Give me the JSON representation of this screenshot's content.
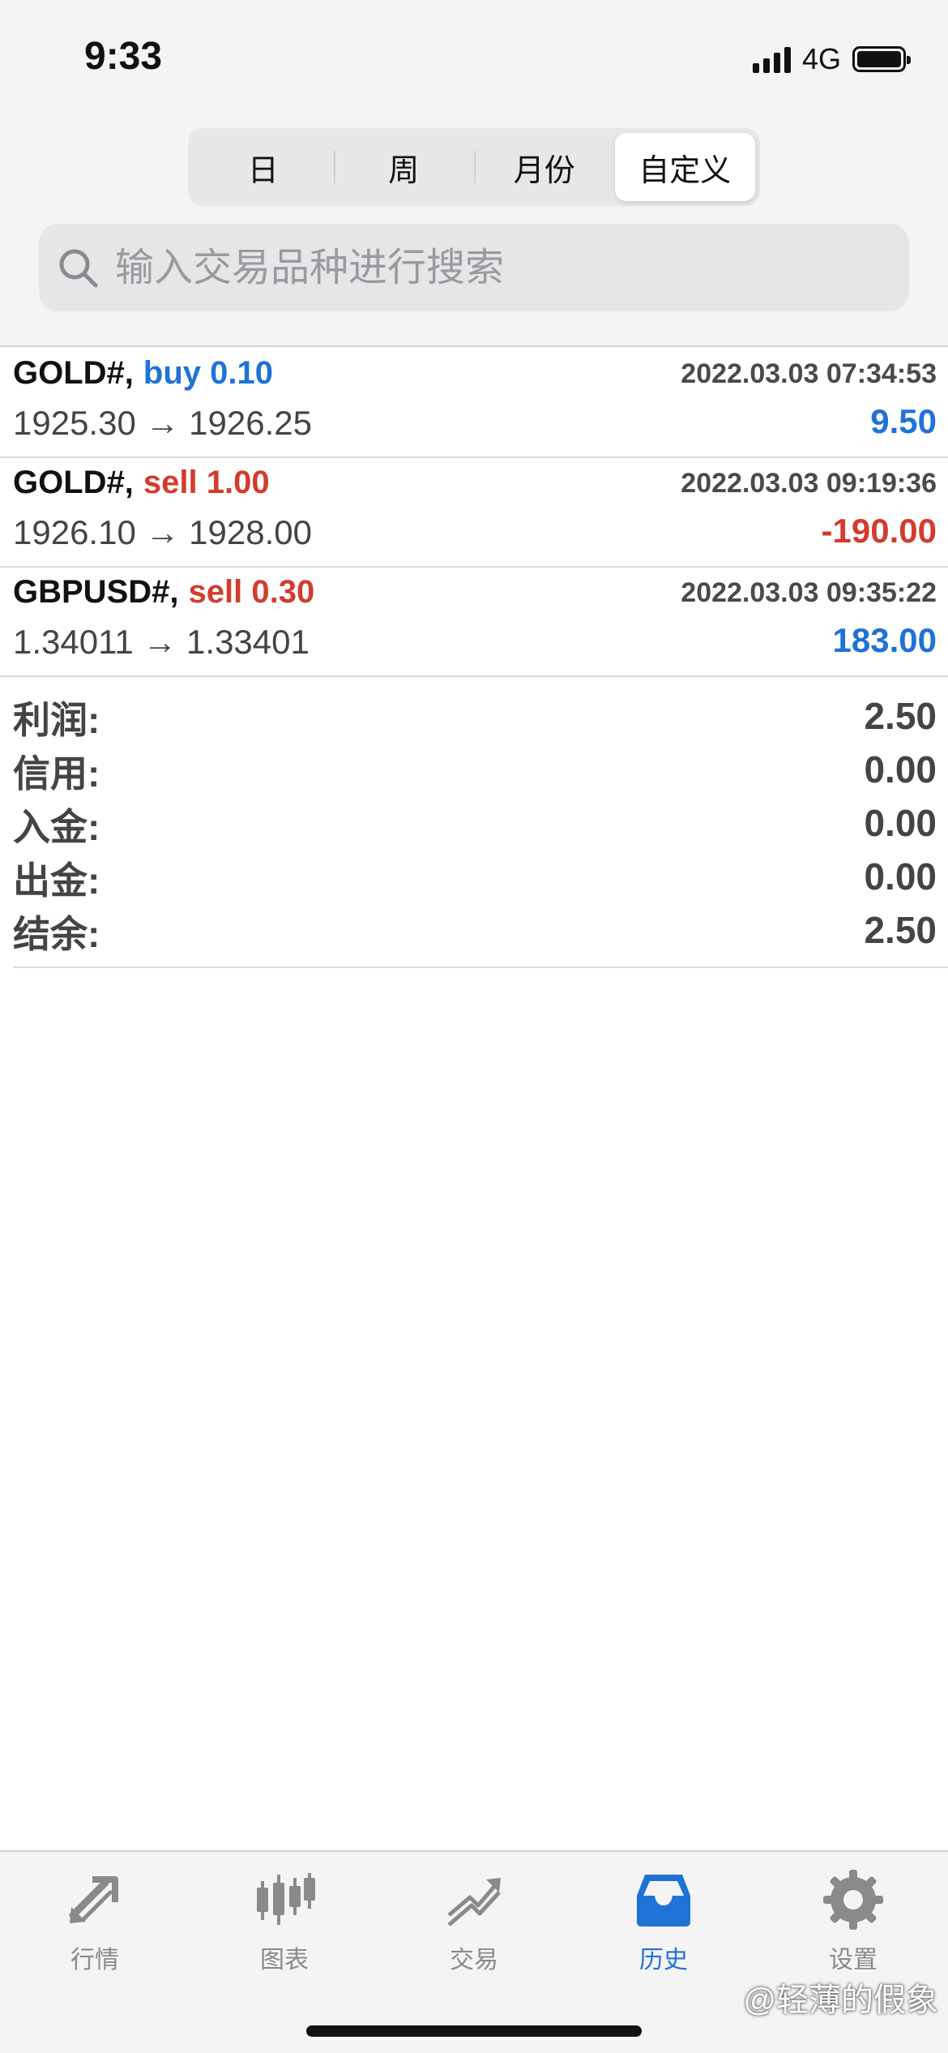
{
  "status_bar": {
    "time": "9:33",
    "network": "4G"
  },
  "periods": {
    "items": [
      "日",
      "周",
      "月份",
      "自定义"
    ],
    "selected": "自定义"
  },
  "search": {
    "placeholder": "输入交易品种进行搜索"
  },
  "deals": [
    {
      "symbol": "GOLD#,",
      "direction": "buy 0.10",
      "side": "buy",
      "time": "2022.03.03 07:34:53",
      "prices": "1925.30 → 1926.25",
      "profit": "9.50"
    },
    {
      "symbol": "GOLD#,",
      "direction": "sell 1.00",
      "side": "sell",
      "time": "2022.03.03 09:19:36",
      "prices": "1926.10 → 1928.00",
      "profit": "-190.00"
    },
    {
      "symbol": "GBPUSD#,",
      "direction": "sell 0.30",
      "side": "sell",
      "time": "2022.03.03 09:35:22",
      "prices": "1.34011 → 1.33401",
      "profit": "183.00"
    }
  ],
  "summary": [
    {
      "label": "利润:",
      "value": "2.50"
    },
    {
      "label": "信用:",
      "value": "0.00"
    },
    {
      "label": "入金:",
      "value": "0.00"
    },
    {
      "label": "出金:",
      "value": "0.00"
    },
    {
      "label": "结余:",
      "value": "2.50"
    }
  ],
  "tabs": [
    {
      "label": "行情",
      "icon": "quotes-icon"
    },
    {
      "label": "图表",
      "icon": "chart-icon"
    },
    {
      "label": "交易",
      "icon": "trade-icon"
    },
    {
      "label": "历史",
      "icon": "history-icon",
      "active": true
    },
    {
      "label": "设置",
      "icon": "settings-icon"
    }
  ],
  "watermark": "@轻薄的假象",
  "colors": {
    "accent": "#1f72d6",
    "loss": "#d23c2e",
    "inactive": "#8a8a8a"
  }
}
